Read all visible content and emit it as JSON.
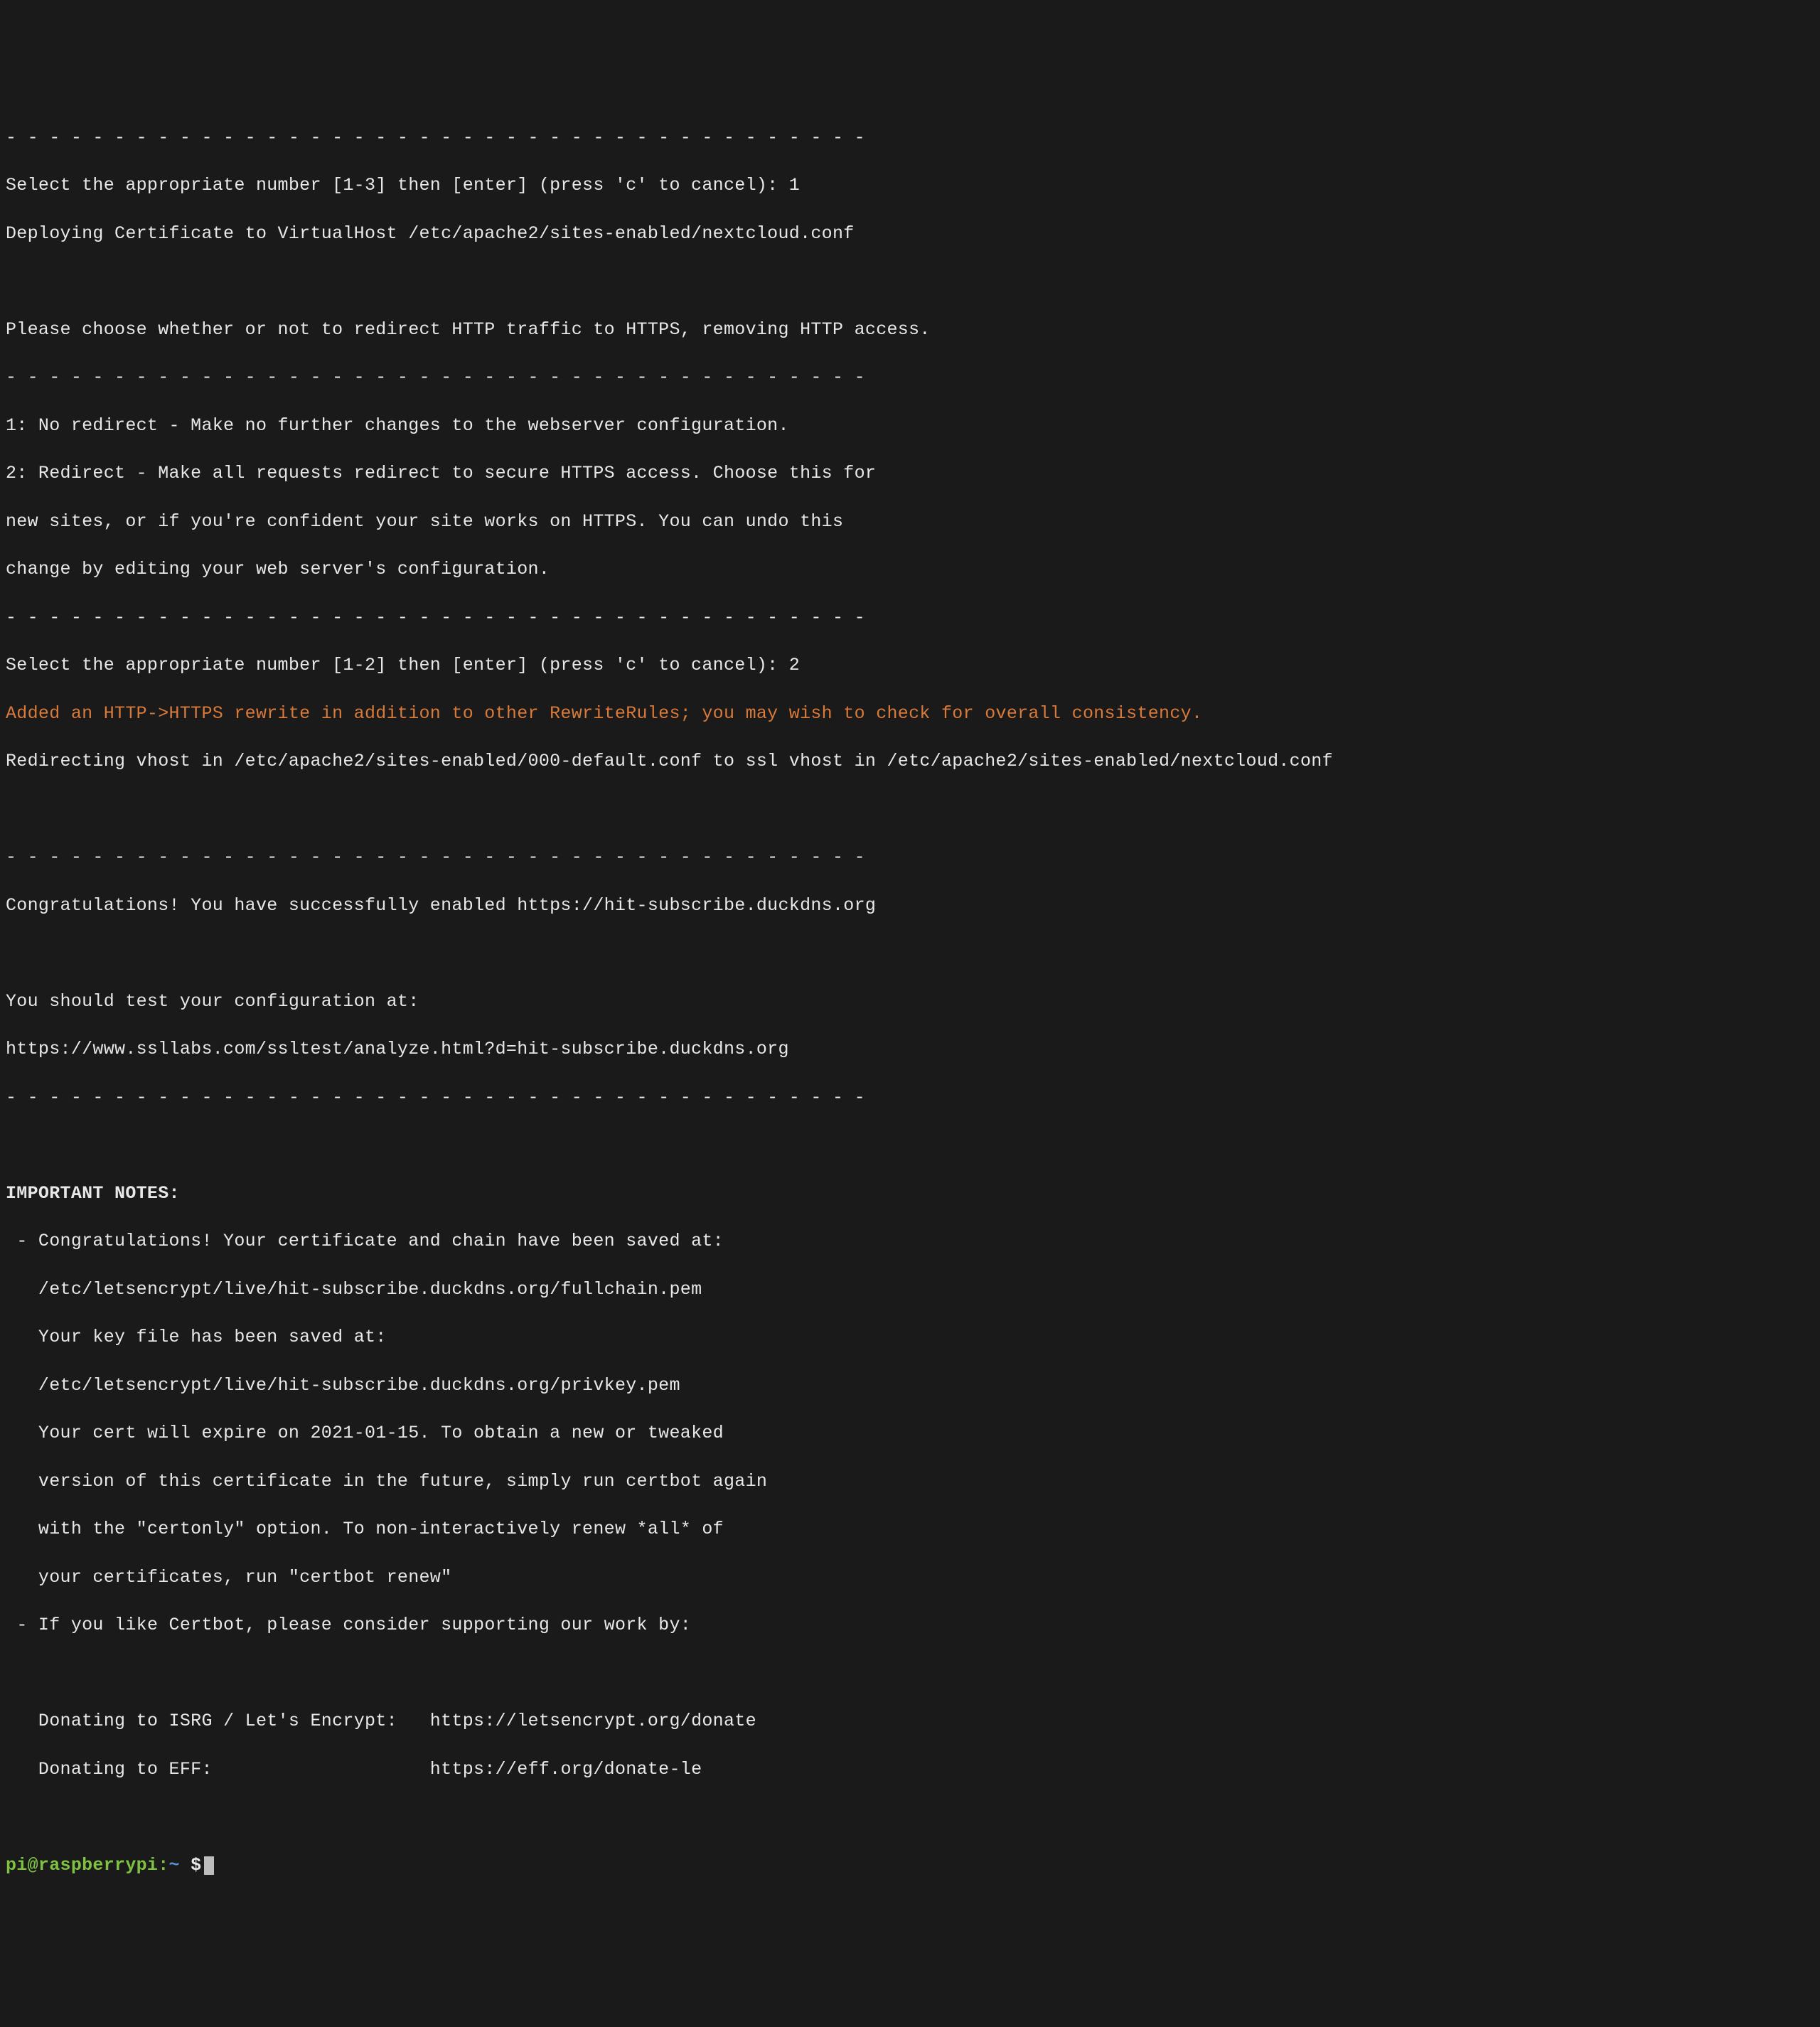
{
  "lines": {
    "dashTop": "- - - - - - - - - - - - - - - - - - - - - - - - - - - - - - - - - - - - - - - -",
    "selectPrompt1": "Select the appropriate number [1-3] then [enter] (press 'c' to cancel): 1",
    "deploying": "Deploying Certificate to VirtualHost /etc/apache2/sites-enabled/nextcloud.conf",
    "chooseHttps": "Please choose whether or not to redirect HTTP traffic to HTTPS, removing HTTP access.",
    "dash1": "- - - - - - - - - - - - - - - - - - - - - - - - - - - - - - - - - - - - - - - -",
    "noRedirect": "1: No redirect - Make no further changes to the webserver configuration.",
    "redirect1": "2: Redirect - Make all requests redirect to secure HTTPS access. Choose this for",
    "redirect2": "new sites, or if you're confident your site works on HTTPS. You can undo this",
    "redirect3": "change by editing your web server's configuration.",
    "dash2": "- - - - - - - - - - - - - - - - - - - - - - - - - - - - - - - - - - - - - - - -",
    "selectPrompt2": "Select the appropriate number [1-2] then [enter] (press 'c' to cancel): 2",
    "httpsRewrite": "Added an HTTP->HTTPS rewrite in addition to other RewriteRules; you may wish to check for overall consistency.",
    "redirecting": "Redirecting vhost in /etc/apache2/sites-enabled/000-default.conf to ssl vhost in /etc/apache2/sites-enabled/nextcloud.conf",
    "dash3": "- - - - - - - - - - - - - - - - - - - - - - - - - - - - - - - - - - - - - - - -",
    "congrats": "Congratulations! You have successfully enabled https://hit-subscribe.duckdns.org",
    "testConfig": "You should test your configuration at:",
    "sslLabs": "https://www.ssllabs.com/ssltest/analyze.html?d=hit-subscribe.duckdns.org",
    "dash4": "- - - - - - - - - - - - - - - - - - - - - - - - - - - - - - - - - - - - - - - -",
    "importantNotes": "IMPORTANT NOTES:",
    "note1a": " - Congratulations! Your certificate and chain have been saved at:",
    "note1b": "   /etc/letsencrypt/live/hit-subscribe.duckdns.org/fullchain.pem",
    "note1c": "   Your key file has been saved at:",
    "note1d": "   /etc/letsencrypt/live/hit-subscribe.duckdns.org/privkey.pem",
    "note1e": "   Your cert will expire on 2021-01-15. To obtain a new or tweaked",
    "note1f": "   version of this certificate in the future, simply run certbot again",
    "note1g": "   with the \"certonly\" option. To non-interactively renew *all* of",
    "note1h": "   your certificates, run \"certbot renew\"",
    "note2a": " - If you like Certbot, please consider supporting our work by:",
    "donate1": "   Donating to ISRG / Let's Encrypt:   https://letsencrypt.org/donate",
    "donate2": "   Donating to EFF:                    https://eff.org/donate-le"
  },
  "prompt": {
    "userHost": "pi@raspberrypi",
    "colon": ":",
    "tilde": "~ ",
    "dollar": "$"
  }
}
